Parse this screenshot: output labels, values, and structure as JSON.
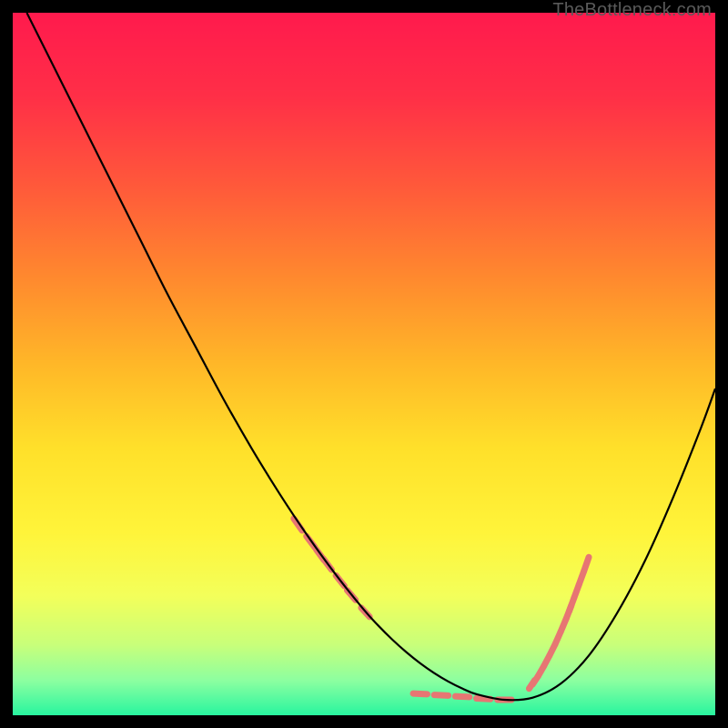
{
  "watermark": "TheBottleneck.com",
  "gradient": {
    "stops": [
      {
        "offset": 0.0,
        "color": "#ff1a4d"
      },
      {
        "offset": 0.12,
        "color": "#ff2f47"
      },
      {
        "offset": 0.25,
        "color": "#ff5a3a"
      },
      {
        "offset": 0.38,
        "color": "#ff8a2e"
      },
      {
        "offset": 0.5,
        "color": "#ffb728"
      },
      {
        "offset": 0.62,
        "color": "#ffe02a"
      },
      {
        "offset": 0.74,
        "color": "#fff43a"
      },
      {
        "offset": 0.83,
        "color": "#f3ff5a"
      },
      {
        "offset": 0.9,
        "color": "#c8ff7a"
      },
      {
        "offset": 0.95,
        "color": "#8dffa0"
      },
      {
        "offset": 1.0,
        "color": "#28f59f"
      }
    ]
  },
  "chart_data": {
    "type": "line",
    "title": "",
    "xlabel": "",
    "ylabel": "",
    "xlim": [
      0,
      100
    ],
    "ylim": [
      0,
      100
    ],
    "series": [
      {
        "name": "curve",
        "x": [
          2,
          6,
          10,
          14,
          18,
          22,
          26,
          30,
          34,
          38,
          42,
          46,
          50,
          52,
          54,
          56,
          58,
          60,
          62,
          64,
          66,
          70,
          74,
          78,
          82,
          86,
          90,
          94,
          98,
          100
        ],
        "y": [
          100,
          92,
          84,
          76,
          68,
          60,
          52.5,
          45,
          38,
          31.5,
          25.5,
          20,
          15,
          12.8,
          10.8,
          9.0,
          7.4,
          6.0,
          4.8,
          3.8,
          3.0,
          2.2,
          2.5,
          4.5,
          8.5,
          14.5,
          22.0,
          31.0,
          41.0,
          46.5
        ]
      }
    ],
    "dash_clusters": [
      {
        "name": "left-cluster",
        "segments": [
          {
            "x1": 40.0,
            "y1": 28.0,
            "x2": 41.2,
            "y2": 26.3
          },
          {
            "x1": 41.8,
            "y1": 25.5,
            "x2": 43.0,
            "y2": 23.9
          },
          {
            "x1": 43.2,
            "y1": 23.6,
            "x2": 44.3,
            "y2": 22.1
          },
          {
            "x1": 44.2,
            "y1": 22.3,
            "x2": 45.4,
            "y2": 20.7
          },
          {
            "x1": 46.0,
            "y1": 19.9,
            "x2": 47.2,
            "y2": 18.4
          },
          {
            "x1": 47.6,
            "y1": 17.8,
            "x2": 48.8,
            "y2": 16.4
          },
          {
            "x1": 49.6,
            "y1": 15.3,
            "x2": 50.8,
            "y2": 14.0
          }
        ]
      },
      {
        "name": "bottom-cluster",
        "segments": [
          {
            "x1": 57.0,
            "y1": 3.1,
            "x2": 59.0,
            "y2": 3.0
          },
          {
            "x1": 60.0,
            "y1": 2.9,
            "x2": 62.0,
            "y2": 2.8
          },
          {
            "x1": 63.0,
            "y1": 2.7,
            "x2": 65.0,
            "y2": 2.6
          },
          {
            "x1": 66.0,
            "y1": 2.4,
            "x2": 68.0,
            "y2": 2.3
          },
          {
            "x1": 69.0,
            "y1": 2.2,
            "x2": 71.0,
            "y2": 2.2
          }
        ]
      },
      {
        "name": "right-cluster",
        "segments": [
          {
            "x1": 73.5,
            "y1": 3.8,
            "x2": 74.3,
            "y2": 5.0
          },
          {
            "x1": 74.0,
            "y1": 4.4,
            "x2": 74.8,
            "y2": 5.6
          },
          {
            "x1": 74.8,
            "y1": 5.6,
            "x2": 75.6,
            "y2": 7.0
          },
          {
            "x1": 75.6,
            "y1": 7.0,
            "x2": 76.4,
            "y2": 8.5
          },
          {
            "x1": 76.4,
            "y1": 8.5,
            "x2": 77.2,
            "y2": 10.1
          },
          {
            "x1": 77.2,
            "y1": 10.1,
            "x2": 78.0,
            "y2": 11.9
          },
          {
            "x1": 78.0,
            "y1": 11.9,
            "x2": 78.8,
            "y2": 13.8
          },
          {
            "x1": 78.8,
            "y1": 13.8,
            "x2": 79.5,
            "y2": 15.6
          },
          {
            "x1": 79.2,
            "y1": 14.8,
            "x2": 79.9,
            "y2": 16.7
          },
          {
            "x1": 79.9,
            "y1": 16.7,
            "x2": 80.6,
            "y2": 18.6
          },
          {
            "x1": 80.6,
            "y1": 18.6,
            "x2": 81.3,
            "y2": 20.5
          },
          {
            "x1": 81.3,
            "y1": 20.5,
            "x2": 82.0,
            "y2": 22.5
          }
        ]
      }
    ]
  },
  "styles": {
    "curve_stroke": "#000000",
    "curve_width": 2.2,
    "dash_stroke": "#e77673",
    "dash_width": 7,
    "dash_linecap": "round"
  }
}
